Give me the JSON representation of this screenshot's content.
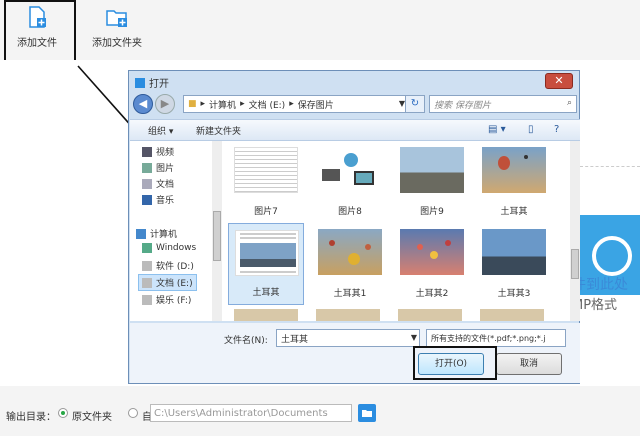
{
  "toolbar": {
    "add_file": "添加文件",
    "add_folder": "添加文件夹"
  },
  "dropzone": {
    "line1": "件到此处",
    "line2": "MP格式"
  },
  "output": {
    "label": "输出目录：",
    "option_source": "原文件夹",
    "option_custom": "自定义",
    "path": "C:\\Users\\Administrator\\Documents",
    "selected": "原文件夹"
  },
  "dialog": {
    "title": "打开",
    "close": "✕",
    "address": [
      "计算机",
      "文档 (E:)",
      "保存图片"
    ],
    "search_placeholder": "搜索 保存图片",
    "organize": "组织 ▾",
    "new_folder": "新建文件夹",
    "sidebar": [
      {
        "label": "视频",
        "icon": "video-icon"
      },
      {
        "label": "图片",
        "icon": "picture-icon"
      },
      {
        "label": "文档",
        "icon": "document-icon"
      },
      {
        "label": "音乐",
        "icon": "music-icon"
      },
      {
        "label": "计算机",
        "icon": "computer-icon"
      },
      {
        "label": "Windows",
        "icon": "windows-drive-icon"
      },
      {
        "label": "软件 (D:)",
        "icon": "drive-icon"
      },
      {
        "label": "文档 (E:)",
        "icon": "drive-icon"
      },
      {
        "label": "娱乐 (F:)",
        "icon": "drive-icon"
      }
    ],
    "files": [
      {
        "name": "图片7",
        "kind": "doc"
      },
      {
        "name": "图片8",
        "kind": "devices"
      },
      {
        "name": "图片9",
        "kind": "street"
      },
      {
        "name": "土耳其",
        "kind": "balloon"
      },
      {
        "name": "土耳其",
        "kind": "doc-city",
        "selected": true
      },
      {
        "name": "土耳其1",
        "kind": "balloons"
      },
      {
        "name": "土耳其2",
        "kind": "balloons2"
      },
      {
        "name": "土耳其3",
        "kind": "city"
      }
    ],
    "filename_label": "文件名(N):",
    "filename_value": "土耳其",
    "filetype": "所有支持的文件(*.pdf;*.png;*.j",
    "open_button": "打开(O)",
    "cancel_button": "取消"
  },
  "colors": {
    "accent": "#2b8de0",
    "dialog_bg": "#cfe0f2",
    "radio_selected": "#28a745"
  }
}
